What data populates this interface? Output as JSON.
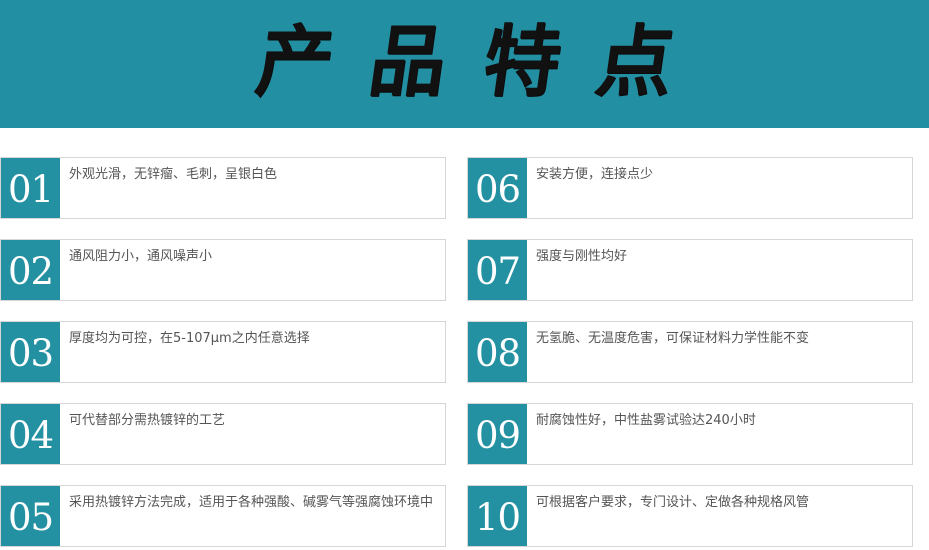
{
  "header": {
    "title_chars": [
      "产",
      "品",
      "特",
      "点"
    ],
    "background_color": "#238fa2"
  },
  "features": [
    {
      "num": "01",
      "text": "外观光滑，无锌瘤、毛刺，呈银白色"
    },
    {
      "num": "02",
      "text": "通风阻力小，通风噪声小"
    },
    {
      "num": "03",
      "text": "厚度均为可控，在5-107μm之内任意选择"
    },
    {
      "num": "04",
      "text": "可代替部分需热镀锌的工艺"
    },
    {
      "num": "05",
      "text": "采用热镀锌方法完成，适用于各种强酸、碱雾气等强腐蚀环境中"
    },
    {
      "num": "06",
      "text": "安装方便，连接点少"
    },
    {
      "num": "07",
      "text": "强度与刚性均好"
    },
    {
      "num": "08",
      "text": "无氢脆、无温度危害，可保证材料力学性能不变"
    },
    {
      "num": "09",
      "text": "耐腐蚀性好，中性盐雾试验达240小时"
    },
    {
      "num": "10",
      "text": "可根据客户要求，专门设计、定做各种规格风管"
    }
  ],
  "colors": {
    "accent": "#2491a3",
    "card_border": "#d6d6d6",
    "text": "#555555"
  }
}
